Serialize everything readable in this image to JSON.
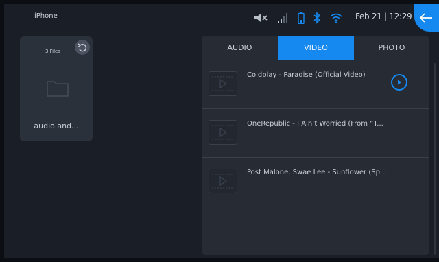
{
  "status_bar": {
    "device_name": "iPhone",
    "datetime": "Feb 21 | 12:29",
    "icons": [
      "mute-icon",
      "signal-icon",
      "battery-icon",
      "bluetooth-icon",
      "wifi-icon"
    ]
  },
  "back_button": {
    "icon": "back-arrow-icon",
    "color": "#1689f0"
  },
  "folder": {
    "files_count": "3 Files",
    "name": "audio and..."
  },
  "tabs": [
    {
      "label": "AUDIO",
      "active": false
    },
    {
      "label": "VIDEO",
      "active": true
    },
    {
      "label": "PHOTO",
      "active": false
    }
  ],
  "videos": [
    {
      "title": "Coldplay - Paradise (Official Video)",
      "playing": true
    },
    {
      "title": "OneRepublic - I Ain’t Worried (From “T...",
      "playing": false
    },
    {
      "title": "Post Malone, Swae Lee - Sunflower (Sp...",
      "playing": false
    }
  ],
  "colors": {
    "accent": "#1689f0",
    "background": "#1a1e26",
    "panel": "#262b34"
  }
}
